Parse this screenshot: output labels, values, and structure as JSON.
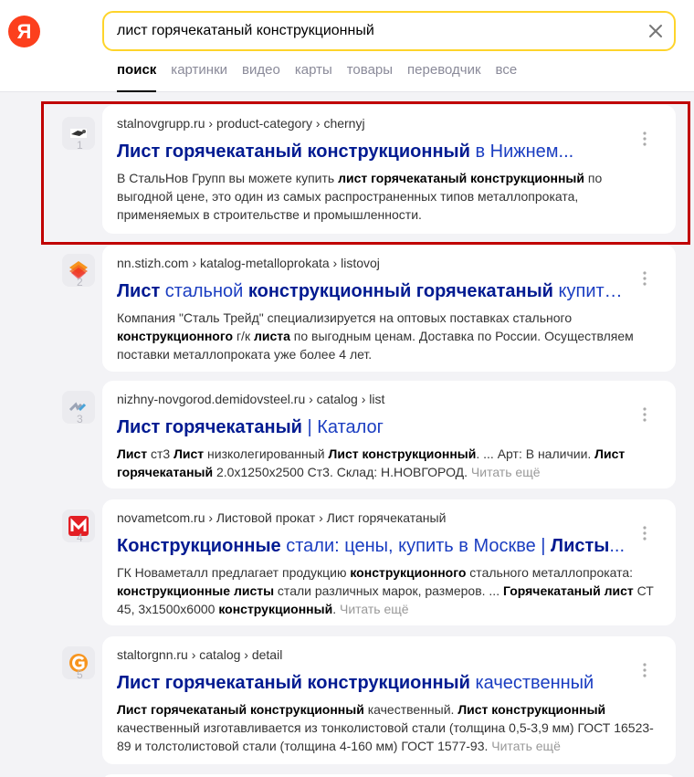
{
  "logo": {
    "text": "Я"
  },
  "search": {
    "query": "лист горячекатаный конструкционный",
    "clear_icon": "close-icon"
  },
  "tabs": [
    {
      "label": "поиск",
      "active": true
    },
    {
      "label": "картинки"
    },
    {
      "label": "видео"
    },
    {
      "label": "карты"
    },
    {
      "label": "товары"
    },
    {
      "label": "переводчик"
    },
    {
      "label": "все"
    }
  ],
  "results": [
    {
      "rank": "1",
      "crumbs": "stalnovgrupp.ru › product-category › chernyj",
      "title": [
        {
          "t": "Лист горячекатаный конструкционный",
          "b": true
        },
        {
          "t": " в Нижнем..."
        }
      ],
      "snippet": [
        {
          "t": "В СтальНов Групп вы можете купить "
        },
        {
          "t": "лист горячекатаный конструкционный",
          "b": true
        },
        {
          "t": " по выгодной цене, это один из самых распространенных типов металлопроката, применяемых в строительстве и промышленности."
        }
      ]
    },
    {
      "rank": "2",
      "crumbs": "nn.stizh.com › katalog-metalloprokata › listovoj",
      "title": [
        {
          "t": "Лист",
          "b": true
        },
        {
          "t": " стальной "
        },
        {
          "t": "конструкционный горячекатаный",
          "b": true
        },
        {
          "t": " купить..."
        }
      ],
      "snippet": [
        {
          "t": "Компания \"Сталь Трейд\" специализируется на оптовых поставках стального "
        },
        {
          "t": "конструкционного",
          "b": true
        },
        {
          "t": " г/к "
        },
        {
          "t": "листа",
          "b": true
        },
        {
          "t": " по выгодным ценам. Доставка по России. Осуществляем поставки металлопроката уже более 4 лет."
        }
      ]
    },
    {
      "rank": "3",
      "crumbs": "nizhny-novgorod.demidovsteel.ru › catalog › list",
      "title": [
        {
          "t": "Лист горячекатаный",
          "b": true
        },
        {
          "t": " | Каталог"
        }
      ],
      "snippet": [
        {
          "t": "Лист",
          "b": true
        },
        {
          "t": " ст3 "
        },
        {
          "t": "Лист",
          "b": true
        },
        {
          "t": " низколегированный "
        },
        {
          "t": "Лист конструкционный",
          "b": true
        },
        {
          "t": ". ... Арт: В наличии. "
        },
        {
          "t": "Лист горячекатаный",
          "b": true
        },
        {
          "t": " 2.0x1250x2500 Ст3. Склад: Н.НОВГОРОД. "
        }
      ],
      "more": "Читать ещё"
    },
    {
      "rank": "4",
      "crumbs": "novametcom.ru › Листовой прокат › Лист горячекатаный",
      "title": [
        {
          "t": "Конструкционные",
          "b": true
        },
        {
          "t": " стали: цены, купить в Москве | "
        },
        {
          "t": "Листы",
          "b": true
        },
        {
          "t": "..."
        }
      ],
      "snippet": [
        {
          "t": "ГК Новаметалл предлагает продукцию "
        },
        {
          "t": "конструкционного",
          "b": true
        },
        {
          "t": " стального металлопроката: "
        },
        {
          "t": "конструкционные листы",
          "b": true
        },
        {
          "t": " стали различных марок, размеров. ... "
        },
        {
          "t": "Горячекатаный лист",
          "b": true
        },
        {
          "t": " СТ 45, 3х1500х6000 "
        },
        {
          "t": "конструкционный",
          "b": true
        },
        {
          "t": ". "
        }
      ],
      "more": "Читать ещё"
    },
    {
      "rank": "5",
      "crumbs": "staltorgnn.ru › catalog › detail",
      "title": [
        {
          "t": "Лист горячекатаный конструкционный",
          "b": true
        },
        {
          "t": " качественный"
        }
      ],
      "snippet": [
        {
          "t": "Лист горячекатаный конструкционный",
          "b": true
        },
        {
          "t": " качественный. "
        },
        {
          "t": "Лист конструкционный",
          "b": true
        },
        {
          "t": " качественный изготавливается из тонколистовой стали (толщина 0,5-3,9 мм) ГОСТ 16523-89 и толстолистовой стали (толщина 4-160 мм) ГОСТ 1577-93. "
        }
      ],
      "more": "Читать ещё"
    }
  ],
  "colors": {
    "accent": "#fed42b",
    "link": "#1a3dc1",
    "brand": "#fc3f1d",
    "highlight": "#c00000"
  }
}
